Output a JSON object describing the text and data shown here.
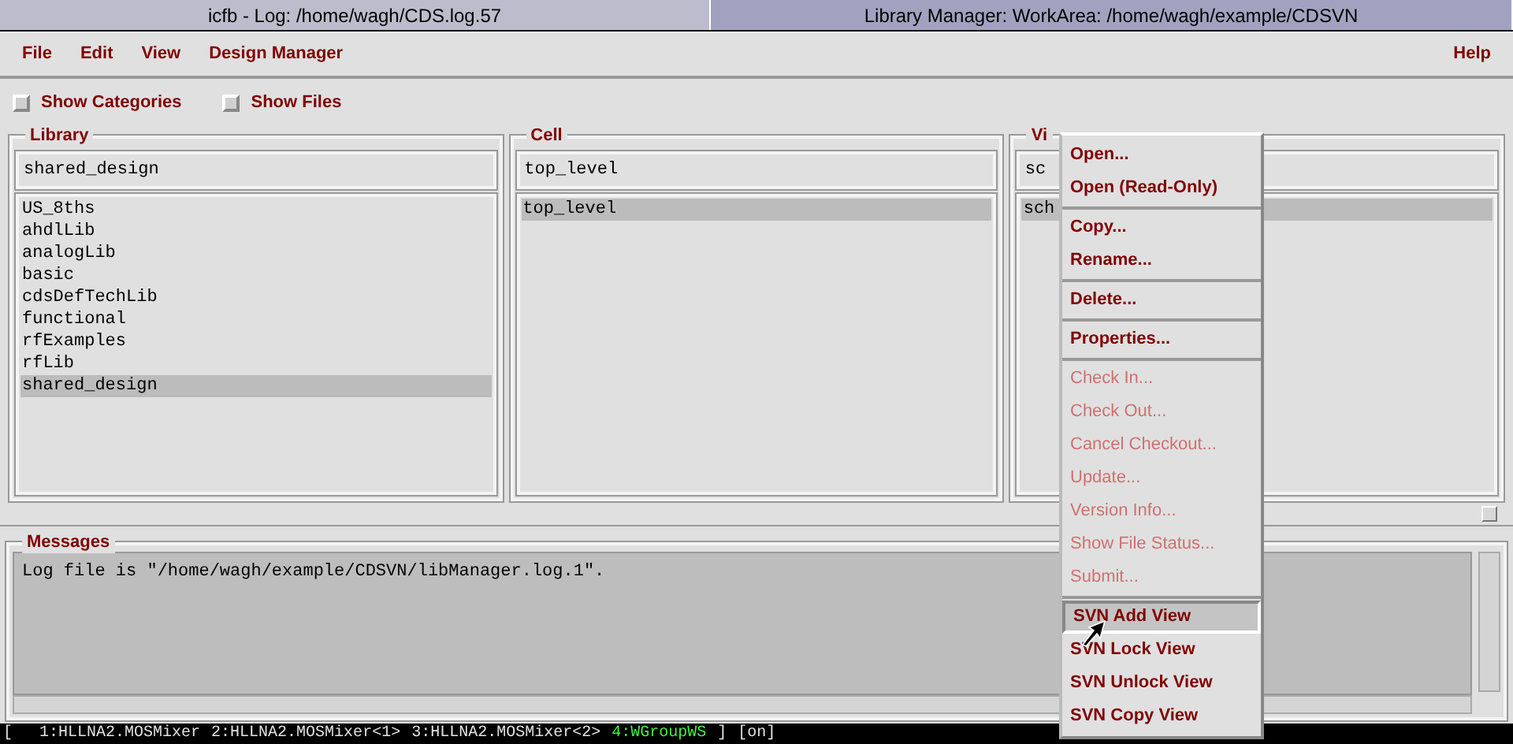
{
  "titles": [
    {
      "text": "icfb - Log: /home/wagh/CDS.log.57",
      "selected": false
    },
    {
      "text": "Library Manager: WorkArea: /home/wagh/example/CDSVN",
      "selected": true
    }
  ],
  "menu": [
    "File",
    "Edit",
    "View",
    "Design Manager"
  ],
  "help": "Help",
  "options": [
    {
      "label": "Show Categories",
      "checked": false
    },
    {
      "label": "Show Files",
      "checked": false
    }
  ],
  "panels": [
    {
      "label": "Library",
      "value": "shared_design",
      "items": [
        {
          "text": "US_8ths",
          "selected": false
        },
        {
          "text": "ahdlLib",
          "selected": false
        },
        {
          "text": "analogLib",
          "selected": false
        },
        {
          "text": "basic",
          "selected": false
        },
        {
          "text": "cdsDefTechLib",
          "selected": false
        },
        {
          "text": "functional",
          "selected": false
        },
        {
          "text": "rfExamples",
          "selected": false
        },
        {
          "text": "rfLib",
          "selected": false
        },
        {
          "text": "shared_design",
          "selected": true
        }
      ]
    },
    {
      "label": "Cell",
      "value": "top_level",
      "items": [
        {
          "text": "top_level",
          "selected": true
        }
      ]
    },
    {
      "label": "Vi",
      "value": "sc",
      "items": [
        {
          "text": "sch",
          "selected": true
        }
      ]
    }
  ],
  "messages": {
    "label": "Messages",
    "lines": [
      "Log file is \"/home/wagh/example/CDSVN/libManager.log.1\"."
    ]
  },
  "context_menu": {
    "groups": [
      {
        "items": [
          {
            "label": "Open...",
            "disabled": false,
            "selected": false
          },
          {
            "label": "Open (Read-Only)",
            "disabled": false,
            "selected": false
          }
        ]
      },
      {
        "items": [
          {
            "label": "Copy...",
            "disabled": false,
            "selected": false
          },
          {
            "label": "Rename...",
            "disabled": false,
            "selected": false
          }
        ]
      },
      {
        "items": [
          {
            "label": "Delete...",
            "disabled": false,
            "selected": false
          }
        ]
      },
      {
        "items": [
          {
            "label": "Properties...",
            "disabled": false,
            "selected": false
          }
        ]
      },
      {
        "items": [
          {
            "label": "Check In...",
            "disabled": true,
            "selected": false
          },
          {
            "label": "Check Out...",
            "disabled": true,
            "selected": false
          },
          {
            "label": "Cancel Checkout...",
            "disabled": true,
            "selected": false
          },
          {
            "label": "Update...",
            "disabled": true,
            "selected": false
          },
          {
            "label": "Version Info...",
            "disabled": true,
            "selected": false
          },
          {
            "label": "Show File Status...",
            "disabled": true,
            "selected": false
          },
          {
            "label": "Submit...",
            "disabled": true,
            "selected": false
          }
        ]
      },
      {
        "items": [
          {
            "label": "SVN Add View",
            "disabled": false,
            "selected": true
          },
          {
            "label": "SVN Lock View",
            "disabled": false,
            "selected": false
          },
          {
            "label": "SVN Unlock View",
            "disabled": false,
            "selected": false
          },
          {
            "label": "SVN Copy View",
            "disabled": false,
            "selected": false
          }
        ]
      }
    ]
  },
  "status_bar": {
    "open": "[",
    "workspaces": [
      {
        "text": "1:HLLNA2.MOSMixer",
        "selected": false
      },
      {
        "text": "2:HLLNA2.MOSMixer<1>",
        "selected": false
      },
      {
        "text": "3:HLLNA2.MOSMixer<2>",
        "selected": false
      },
      {
        "text": "4:WGroupWS",
        "selected": true
      }
    ],
    "close": "]",
    "mode": "[on]"
  }
}
